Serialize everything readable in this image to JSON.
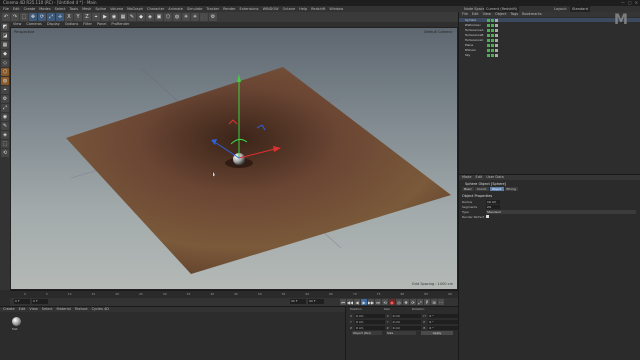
{
  "app": {
    "title": "Cinema 4D R25.110 (RC) - [Untitled 4 *] - Main",
    "window_controls": [
      "—",
      "▢",
      "✕"
    ]
  },
  "menu": {
    "items": [
      "File",
      "Edit",
      "Create",
      "Modes",
      "Select",
      "Tools",
      "Mesh",
      "Spline",
      "Volume",
      "MoGraph",
      "Character",
      "Animate",
      "Simulate",
      "Tracker",
      "Render",
      "Extensions",
      "WINDOW",
      "Octane",
      "Help",
      "Redshift",
      "Window"
    ],
    "right": {
      "node_space_label": "Node Space:",
      "node_space_value": "Current (Redshift)",
      "layout_label": "Layout:",
      "layout_value": "Standard"
    }
  },
  "toolbar": {
    "buttons": [
      "↶",
      "↷",
      "⬚",
      "✥",
      "⟳",
      "⤢",
      "✛",
      "X",
      "Y",
      "Z",
      "⌖",
      "▶",
      "◉",
      "▦",
      "✎",
      "◆",
      "◈",
      "▣",
      "⬡",
      "◍",
      "✳",
      "☀",
      "🎥",
      "⚙"
    ]
  },
  "left_tools": [
    "◩",
    "◪",
    "▦",
    "◆",
    "◇",
    "⬡",
    "◍",
    "⌖",
    "⚙",
    "⤢",
    "◉",
    "✎",
    "◈",
    "⬚",
    "⟲"
  ],
  "viewport": {
    "menu": [
      "View",
      "Cameras",
      "Display",
      "Options",
      "Filter",
      "Panel",
      "ProRender"
    ],
    "label_left": "Perspective",
    "label_right": "Default Camera ·",
    "grid_spacing": "Grid Spacing : 1000 cm",
    "colors": {
      "top": "#5e6770",
      "bottom": "#b4b9b6",
      "plane": "#6a4432"
    }
  },
  "timeline": {
    "ticks": [
      "0",
      "5",
      "10",
      "15",
      "20",
      "25",
      "30",
      "35",
      "40",
      "45",
      "50",
      "55",
      "60",
      "65",
      "70",
      "75",
      "80",
      "85",
      "90"
    ],
    "current_frame": "0 F",
    "start": "0 F",
    "end": "90 F",
    "end2": "90 F"
  },
  "transport": {
    "buttons": [
      "⏮",
      "◀◀",
      "◀",
      "▶",
      "▶▶",
      "⏭",
      "⟲",
      "●",
      "◎",
      "✥",
      "⟳",
      "⤢",
      "P",
      "⊞",
      "⋯"
    ]
  },
  "material_panel": {
    "menu": [
      "Create",
      "Edit",
      "View",
      "Select",
      "Material",
      "Texture",
      "Cycles 4D"
    ],
    "material_name": "Mat"
  },
  "coordinates": {
    "headers": [
      "Position",
      "Size",
      "Rotation"
    ],
    "rows": [
      {
        "axis": "X",
        "pos": "0 cm",
        "size": "0 cm",
        "rot_label": "H",
        "rot": "0 °"
      },
      {
        "axis": "Y",
        "pos": "0 cm",
        "size": "0 cm",
        "rot_label": "P",
        "rot": "0 °"
      },
      {
        "axis": "Z",
        "pos": "0 cm",
        "size": "0 cm",
        "rot_label": "B",
        "rot": "0 °"
      }
    ],
    "mode_object": "Object (Rel)",
    "mode_size": "Size",
    "apply": "Apply"
  },
  "objects": {
    "menu": [
      "File",
      "Edit",
      "View",
      "Object",
      "Tags",
      "Bookmarks"
    ],
    "items": [
      {
        "name": "Symbol",
        "selected": true
      },
      {
        "name": "RSDomeLi",
        "selected": false
      },
      {
        "name": "TurbulenceA",
        "selected": false
      },
      {
        "name": "TurbulenceB",
        "selected": false
      },
      {
        "name": "TurbulenceC",
        "selected": false
      },
      {
        "name": "Plane",
        "selected": false
      },
      {
        "name": "RSCam",
        "selected": false
      },
      {
        "name": "Sky",
        "selected": false
      }
    ]
  },
  "attributes": {
    "menu": [
      "Mode",
      "Edit",
      "User Data"
    ],
    "title": "Sphere Object [Sphere]",
    "tabs": [
      "Basic",
      "Coord.",
      "Object",
      "Phong"
    ],
    "active_tab": "Object",
    "section": "Object Properties",
    "rows": [
      {
        "label": "Radius",
        "value": "10 cm"
      },
      {
        "label": "Segments",
        "value": "24"
      }
    ],
    "type_label": "Type",
    "type_value": "Standard",
    "render_perfect_label": "Render Perfect"
  },
  "watermark": "M"
}
